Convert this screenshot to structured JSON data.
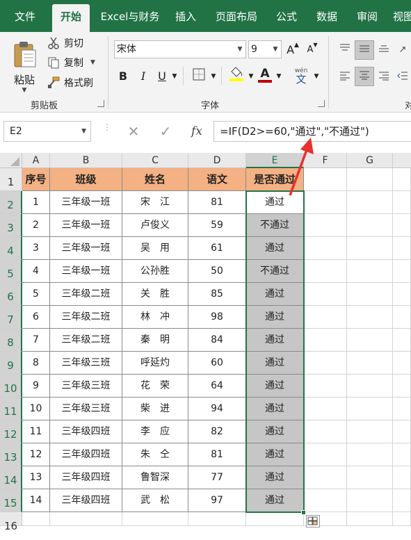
{
  "tabs": [
    "文件",
    "开始",
    "Excel与财务",
    "插入",
    "页面布局",
    "公式",
    "数据",
    "审阅",
    "视图"
  ],
  "active_tab": "开始",
  "clipboard": {
    "paste_label": "粘贴",
    "cut_label": "剪切",
    "copy_label": "复制",
    "format_painter_label": "格式刷",
    "group_label": "剪贴板"
  },
  "font": {
    "name": "宋体",
    "size": "9",
    "bold": "B",
    "italic": "I",
    "underline": "U",
    "font_color_glyph": "A",
    "phonetic_glyph": "wén",
    "phonetic_sub": "文",
    "grow_glyph": "A",
    "shrink_glyph": "A",
    "group_label": "字体"
  },
  "alignment": {
    "group_label_partial": "对"
  },
  "formula_bar": {
    "name_box": "E2",
    "fx": "fx",
    "formula": "=IF(D2>=60,\"通过\",\"不通过\")"
  },
  "columns": [
    "A",
    "B",
    "C",
    "D",
    "E",
    "F",
    "G"
  ],
  "rows": [
    "1",
    "2",
    "3",
    "4",
    "5",
    "6",
    "7",
    "8",
    "9",
    "10",
    "11",
    "12",
    "13",
    "14",
    "15",
    "16"
  ],
  "table": {
    "headers": [
      "序号",
      "班级",
      "姓名",
      "语文",
      "是否通过"
    ],
    "rows": [
      [
        "1",
        "三年级一班",
        "宋　江",
        "81",
        "通过"
      ],
      [
        "2",
        "三年级一班",
        "卢俊义",
        "59",
        "不通过"
      ],
      [
        "3",
        "三年级一班",
        "吴　用",
        "61",
        "通过"
      ],
      [
        "4",
        "三年级一班",
        "公孙胜",
        "50",
        "不通过"
      ],
      [
        "5",
        "三年级二班",
        "关　胜",
        "85",
        "通过"
      ],
      [
        "6",
        "三年级二班",
        "林　冲",
        "98",
        "通过"
      ],
      [
        "7",
        "三年级二班",
        "秦　明",
        "84",
        "通过"
      ],
      [
        "8",
        "三年级三班",
        "呼延灼",
        "60",
        "通过"
      ],
      [
        "9",
        "三年级三班",
        "花　荣",
        "64",
        "通过"
      ],
      [
        "10",
        "三年级三班",
        "柴　进",
        "94",
        "通过"
      ],
      [
        "11",
        "三年级四班",
        "李　应",
        "82",
        "通过"
      ],
      [
        "12",
        "三年级四班",
        "朱　仝",
        "81",
        "通过"
      ],
      [
        "13",
        "三年级四班",
        "鲁智深",
        "77",
        "通过"
      ],
      [
        "14",
        "三年级四班",
        "武　松",
        "97",
        "通过"
      ]
    ]
  },
  "colors": {
    "ribbon_green": "#217346",
    "header_fill": "#f4b183",
    "selection_fill": "#c6c6c6",
    "annotation_arrow": "#e8312e"
  },
  "icons": {
    "paste": "clipboard-icon",
    "cut": "scissors-icon",
    "copy": "copy-icon",
    "format_painter": "brush-icon",
    "borders": "borders-icon",
    "fill": "fill-bucket-icon",
    "cancel": "cancel-icon",
    "enter": "check-icon",
    "quick_analysis": "quick-analysis-icon"
  }
}
